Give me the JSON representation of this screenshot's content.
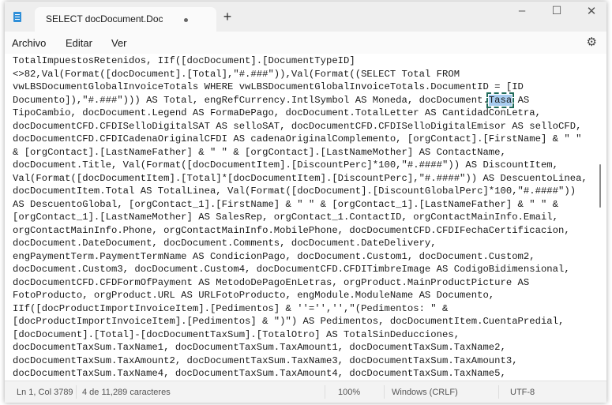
{
  "window": {
    "tab_title": "SELECT docDocument.DocumentID",
    "new_tab": "+",
    "minimize": "–",
    "maximize": "☐",
    "close": "✕"
  },
  "menu": [
    "Archivo",
    "Editar",
    "Ver"
  ],
  "settings_icon": "⚙",
  "editor": {
    "lines": [
      "TotalImpuestosRetenidos, IIf([docDocument].[DocumentTypeID]",
      "<>82,Val(Format([docDocument].[Total],\"#.###\")),Val(Format((SELECT Total FROM",
      "vwLBSDocumentGlobalInvoiceTotals WHERE vwLBSDocumentGlobalInvoiceTotals.DocumentID = [ID",
      "",
      "TipoCambio, docDocument.Legend AS FormaDePago, docDocument.TotalLetter AS CantidadConLetra,",
      "docDocumentCFD.CFDISelloDigitalSAT AS selloSAT, docDocumentCFD.CFDISelloDigitalEmisor AS selloCFD,",
      "docDocumentCFD.CFDICadenaOriginalCFDI AS cadenaOriginalComplemento, [orgContact].[FirstName] & \" \"",
      "& [orgContact].[LastNameFather] & \" \" & [orgContact].[LastNameMother] AS ContactName,",
      "docDocument.Title, Val(Format([docDocumentItem].[DiscountPerc]*100,\"#.####\")) AS DiscountItem,",
      "Val(Format([docDocumentItem].[Total]*[docDocumentItem].[DiscountPerc],\"#.####\")) AS DescuentoLinea,",
      "docDocumentItem.Total AS TotalLinea, Val(Format([docDocument].[DiscountGlobalPerc]*100,\"#.####\"))",
      "AS DescuentoGlobal, [orgContact_1].[FirstName] & \" \" & [orgContact_1].[LastNameFather] & \" \" &",
      "[orgContact_1].[LastNameMother] AS SalesRep, orgContact_1.ContactID, orgContactMainInfo.Email,",
      "orgContactMainInfo.Phone, orgContactMainInfo.MobilePhone, docDocumentCFD.CFDIFechaCertificacion,",
      "docDocument.DateDocument, docDocument.Comments, docDocument.DateDelivery,",
      "engPaymentTerm.PaymentTermName AS CondicionPago, docDocument.Custom1, docDocument.Custom2,",
      "docDocument.Custom3, docDocument.Custom4, docDocumentCFD.CFDITimbreImage AS CodigoBidimensional,",
      "docDocumentCFD.CFDFormOfPayment AS MetodoDePagoEnLetras, orgProduct.MainProductPicture AS",
      "FotoProducto, orgProduct.URL AS URLFotoProducto, engModule.ModuleName AS Documento,",
      "IIf([docProductImportInvoiceItem].[Pedimentos] & ''='','',\"(Pedimentos: \" &",
      "[docProductImportInvoiceItem].[Pedimentos] & \")\") AS Pedimentos, docDocumentItem.CuentaPredial,",
      "[docDocument].[Total]-[docDocumentTaxSum].[TotalOtro] AS TotalSinDeducciones,",
      "docDocumentTaxSum.TaxName1, docDocumentTaxSum.TaxAmount1, docDocumentTaxSum.TaxName2,",
      "docDocumentTaxSum.TaxAmount2, docDocumentTaxSum.TaxName3, docDocumentTaxSum.TaxAmount3,",
      "docDocumentTaxSum.TaxName4, docDocumentTaxSum.TaxAmount4, docDocumentTaxSum.TaxName5,"
    ],
    "selected_line": {
      "before": "Documento]),\"#.###\"))) AS Total, engRefCurrency.IntlSymbol AS Moneda, docDocument.",
      "selected": "Tasa",
      "after": " AS"
    }
  },
  "status": {
    "position": "Ln 1, Col 3789",
    "selection": "4 de 11,289 caracteres",
    "zoom": "100%",
    "line_ending": "Windows (CRLF)",
    "encoding": "UTF-8"
  }
}
